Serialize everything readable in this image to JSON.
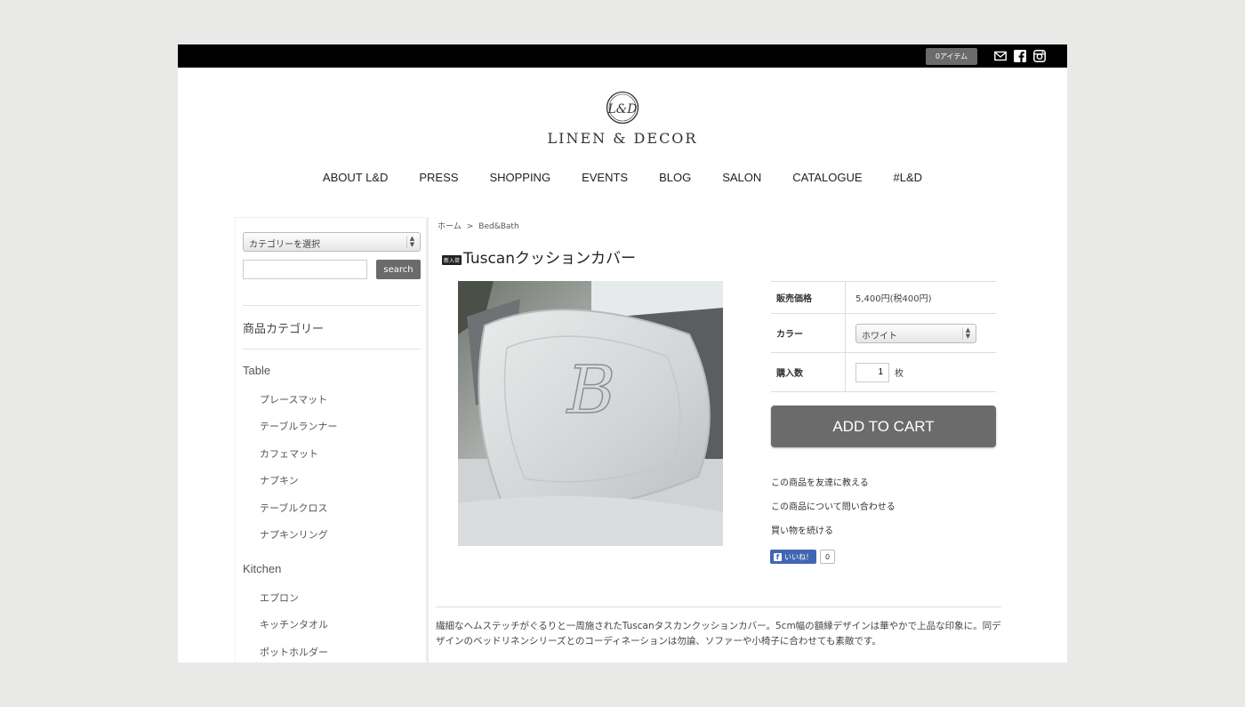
{
  "header": {
    "cart_label": "0アイテム",
    "icons": [
      "mail-icon",
      "facebook-icon",
      "instagram-icon"
    ]
  },
  "logo": {
    "mark": "L&D",
    "text": "LINEN & DECOR"
  },
  "nav": {
    "items": [
      "ABOUT L&D",
      "PRESS",
      "SHOPPING",
      "EVENTS",
      "BLOG",
      "SALON",
      "CATALOGUE",
      "#L&D"
    ]
  },
  "sidebar": {
    "category_select": "カテゴリーを選択",
    "search_label": "search",
    "heading": "商品カテゴリー",
    "groups": [
      {
        "name": "Table",
        "items": [
          "プレースマット",
          "テーブルランナー",
          "カフェマット",
          "ナプキン",
          "テーブルクロス",
          "ナプキンリング"
        ]
      },
      {
        "name": "Kitchen",
        "items": [
          "エプロン",
          "キッチンタオル",
          "ポットホルダー"
        ]
      }
    ]
  },
  "breadcrumb": {
    "home": "ホーム",
    "separator": ">",
    "current": "Bed&Bath"
  },
  "product": {
    "badge": "新入荷",
    "title": "Tuscanクッションカバー",
    "price_label": "販売価格",
    "price_value": "5,400円(税400円)",
    "color_label": "カラー",
    "color_value": "ホワイト",
    "qty_label": "購入数",
    "qty_value": "1",
    "qty_unit": "枚",
    "add_to_cart": "ADD TO CART",
    "links": [
      "この商品を友達に教える",
      "この商品について問い合わせる",
      "買い物を続ける"
    ],
    "fb_like": "いいね！",
    "fb_count": "0",
    "description": "繊細なヘムステッチがぐるりと一周施されたTuscanタスカンクッションカバー。5cm幅の額縁デザインは華やかで上品な印象に。同デザインのベッドリネンシリーズとのコーディネーションは勿論、ソファーや小椅子に合わせても素敵です。",
    "monogram": "B"
  },
  "colors": {
    "topbar": "#000000",
    "button": "#6b6b6b",
    "facebook": "#4267b2"
  }
}
